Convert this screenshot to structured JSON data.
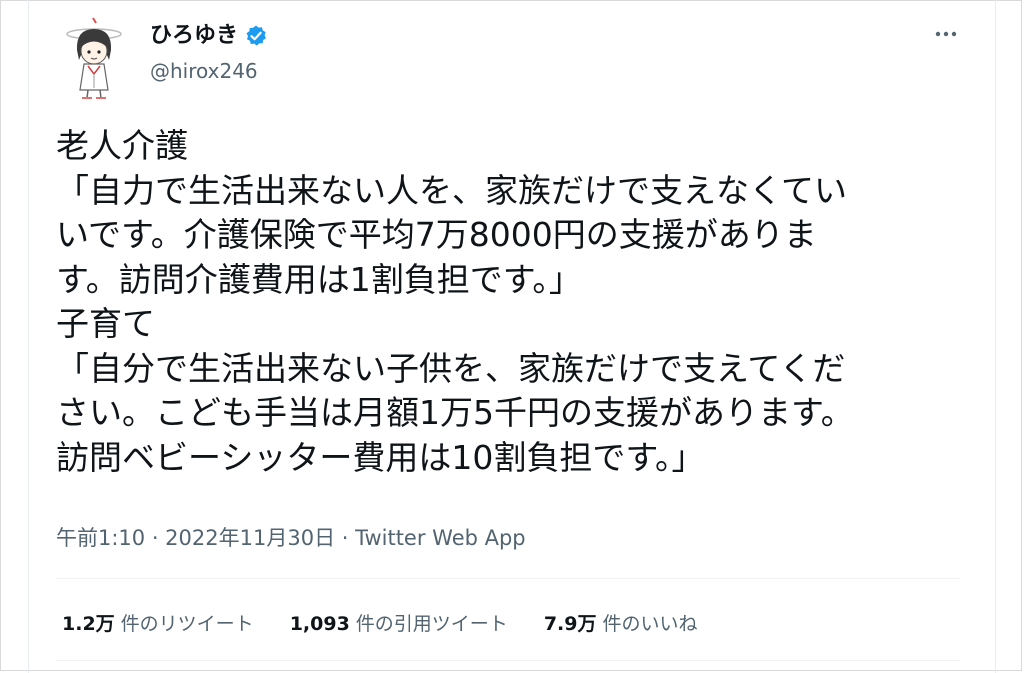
{
  "author": {
    "display_name": "ひろゆき",
    "handle": "@hirox246",
    "verified": true
  },
  "tweet": {
    "lines": [
      "老人介護",
      "「自力で生活出来ない人を、家族だけで支えなくてい",
      "いです。介護保険で平均7万8000円の支援がありま",
      "す。訪問介護費用は1割負担です。」",
      "子育て",
      "「自分で生活出来ない子供を、家族だけで支えてくだ",
      "さい。こども手当は月額1万5千円の支援があります。",
      "訪問ベビーシッター費用は10割負担です。」"
    ]
  },
  "meta": {
    "timestamp": "午前1:10 · 2022年11月30日 · Twitter Web App"
  },
  "stats": {
    "retweets": {
      "count": "1.2万",
      "label": "件のリツイート"
    },
    "quotes": {
      "count": "1,093",
      "label": "件の引用ツイート"
    },
    "likes": {
      "count": "7.9万",
      "label": "件のいいね"
    }
  },
  "colors": {
    "verified_blue": "#1d9bf0",
    "text_primary": "#0f1419",
    "text_secondary": "#536471"
  },
  "icons": {
    "verified": "verified-badge-icon",
    "more": "more-options-icon"
  }
}
